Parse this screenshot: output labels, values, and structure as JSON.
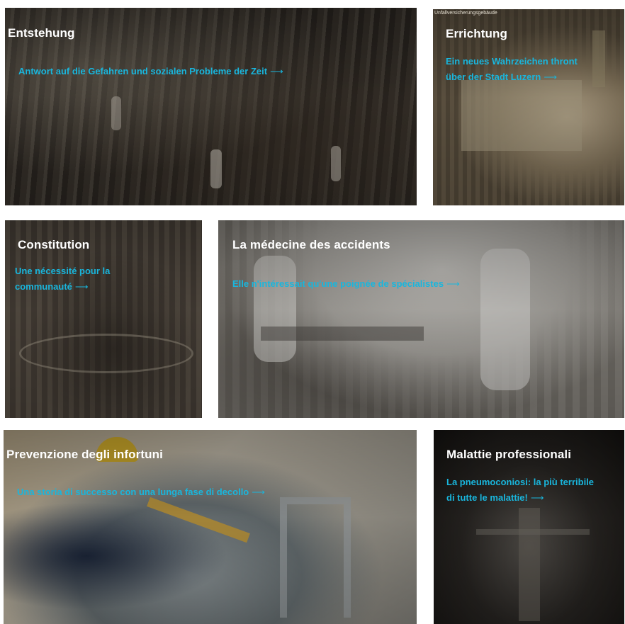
{
  "tiles": [
    {
      "title": "Entstehung",
      "link": "Antwort auf die Gefahren und sozialen Probleme der Zeit",
      "arrow": "⟶"
    },
    {
      "caption": "Unfallversicherungsgebäude",
      "title": "Errichtung",
      "link_line1": "Ein neues Wahrzeichen thront",
      "link_line2": "über der Stadt Luzern",
      "arrow": "⟶"
    },
    {
      "title": "Constitution",
      "link_line1": "Une nécessité pour la",
      "link_line2": "communauté",
      "arrow": "⟶"
    },
    {
      "title": "La médecine des accidents",
      "link": "Elle n'intéressait qu'une poignée de spécialistes",
      "arrow": "⟶"
    },
    {
      "title": "Prevenzione degli infortuni",
      "link": "Una storia di successo con una lunga fase di decollo",
      "arrow": "⟶"
    },
    {
      "title": "Malattie professionali",
      "link_line1": "La pneumoconiosi: la più terribile",
      "link_line2": "di tutte le malattie!",
      "arrow": "⟶"
    }
  ],
  "colors": {
    "link": "#19b6dd",
    "title": "#ffffff"
  }
}
